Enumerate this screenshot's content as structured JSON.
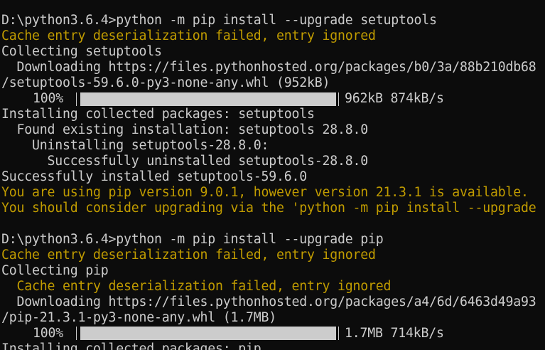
{
  "colors": {
    "background": "#0c0c0c",
    "text": "#cccccc",
    "warning": "#c19c00"
  },
  "lines": [
    "D:\\python3.6.4>python -m pip install --upgrade setuptools",
    "Cache entry deserialization failed, entry ignored",
    "Collecting setuptools",
    "  Downloading https://files.pythonhosted.org/packages/b0/3a/88b210db68",
    "/setuptools-59.6.0-py3-none-any.whl (952kB)",
    "Installing collected packages: setuptools",
    "  Found existing installation: setuptools 28.8.0",
    "    Uninstalling setuptools-28.8.0:",
    "      Successfully uninstalled setuptools-28.8.0",
    "Successfully installed setuptools-59.6.0",
    "You are using pip version 9.0.1, however version 21.3.1 is available.",
    "You should consider upgrading via the 'python -m pip install --upgrade",
    "D:\\python3.6.4>python -m pip install --upgrade pip",
    "Cache entry deserialization failed, entry ignored",
    "Collecting pip",
    "  Cache entry deserialization failed, entry ignored",
    "  Downloading https://files.pythonhosted.org/packages/a4/6d/6463d49a93",
    "/pip-21.3.1-py3-none-any.whl (1.7MB)",
    "Installing collected packages: pip"
  ],
  "downloads": [
    {
      "percent_label": "100%",
      "fill_fraction": 1.0,
      "stats": "962kB 874kB/s"
    },
    {
      "percent_label": "100%",
      "fill_fraction": 1.0,
      "stats": "1.7MB 714kB/s"
    }
  ]
}
